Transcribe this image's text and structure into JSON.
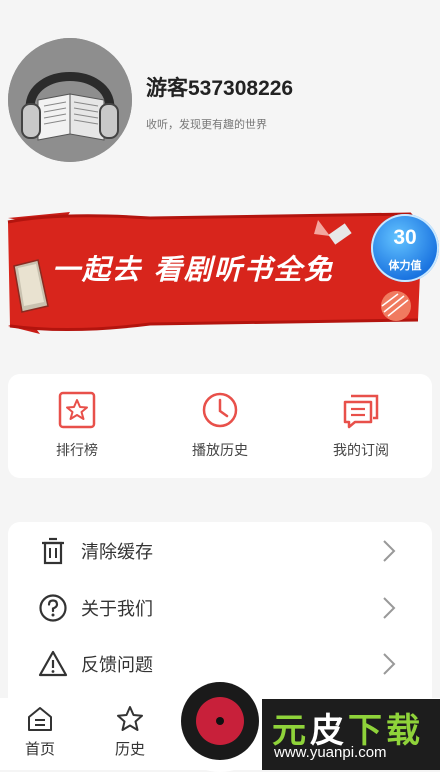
{
  "profile": {
    "username": "游客537308226",
    "tagline": "收听，发现更有趣的世界"
  },
  "banner": {
    "text": "一起去 看剧听书全免",
    "badge_number": "30",
    "badge_label": "体力值"
  },
  "quick_actions": [
    {
      "label": "排行榜",
      "icon": "star-box-icon"
    },
    {
      "label": "播放历史",
      "icon": "clock-icon"
    },
    {
      "label": "我的订阅",
      "icon": "subscription-icon"
    }
  ],
  "menu": [
    {
      "label": "清除缓存",
      "icon": "trash-icon"
    },
    {
      "label": "关于我们",
      "icon": "question-icon"
    },
    {
      "label": "反馈问题",
      "icon": "warning-icon"
    }
  ],
  "bottom_nav": [
    {
      "label": "首页",
      "icon": "home-icon"
    },
    {
      "label": "历史",
      "icon": "star-outline-icon"
    }
  ],
  "watermark": {
    "title_part1": "元",
    "title_part2": "皮",
    "title_part3": "下载",
    "url": "www.yuanpi.com"
  },
  "colors": {
    "accent": "#e8504a",
    "banner_red": "#d8251c",
    "badge_blue": "#1a73e0"
  }
}
